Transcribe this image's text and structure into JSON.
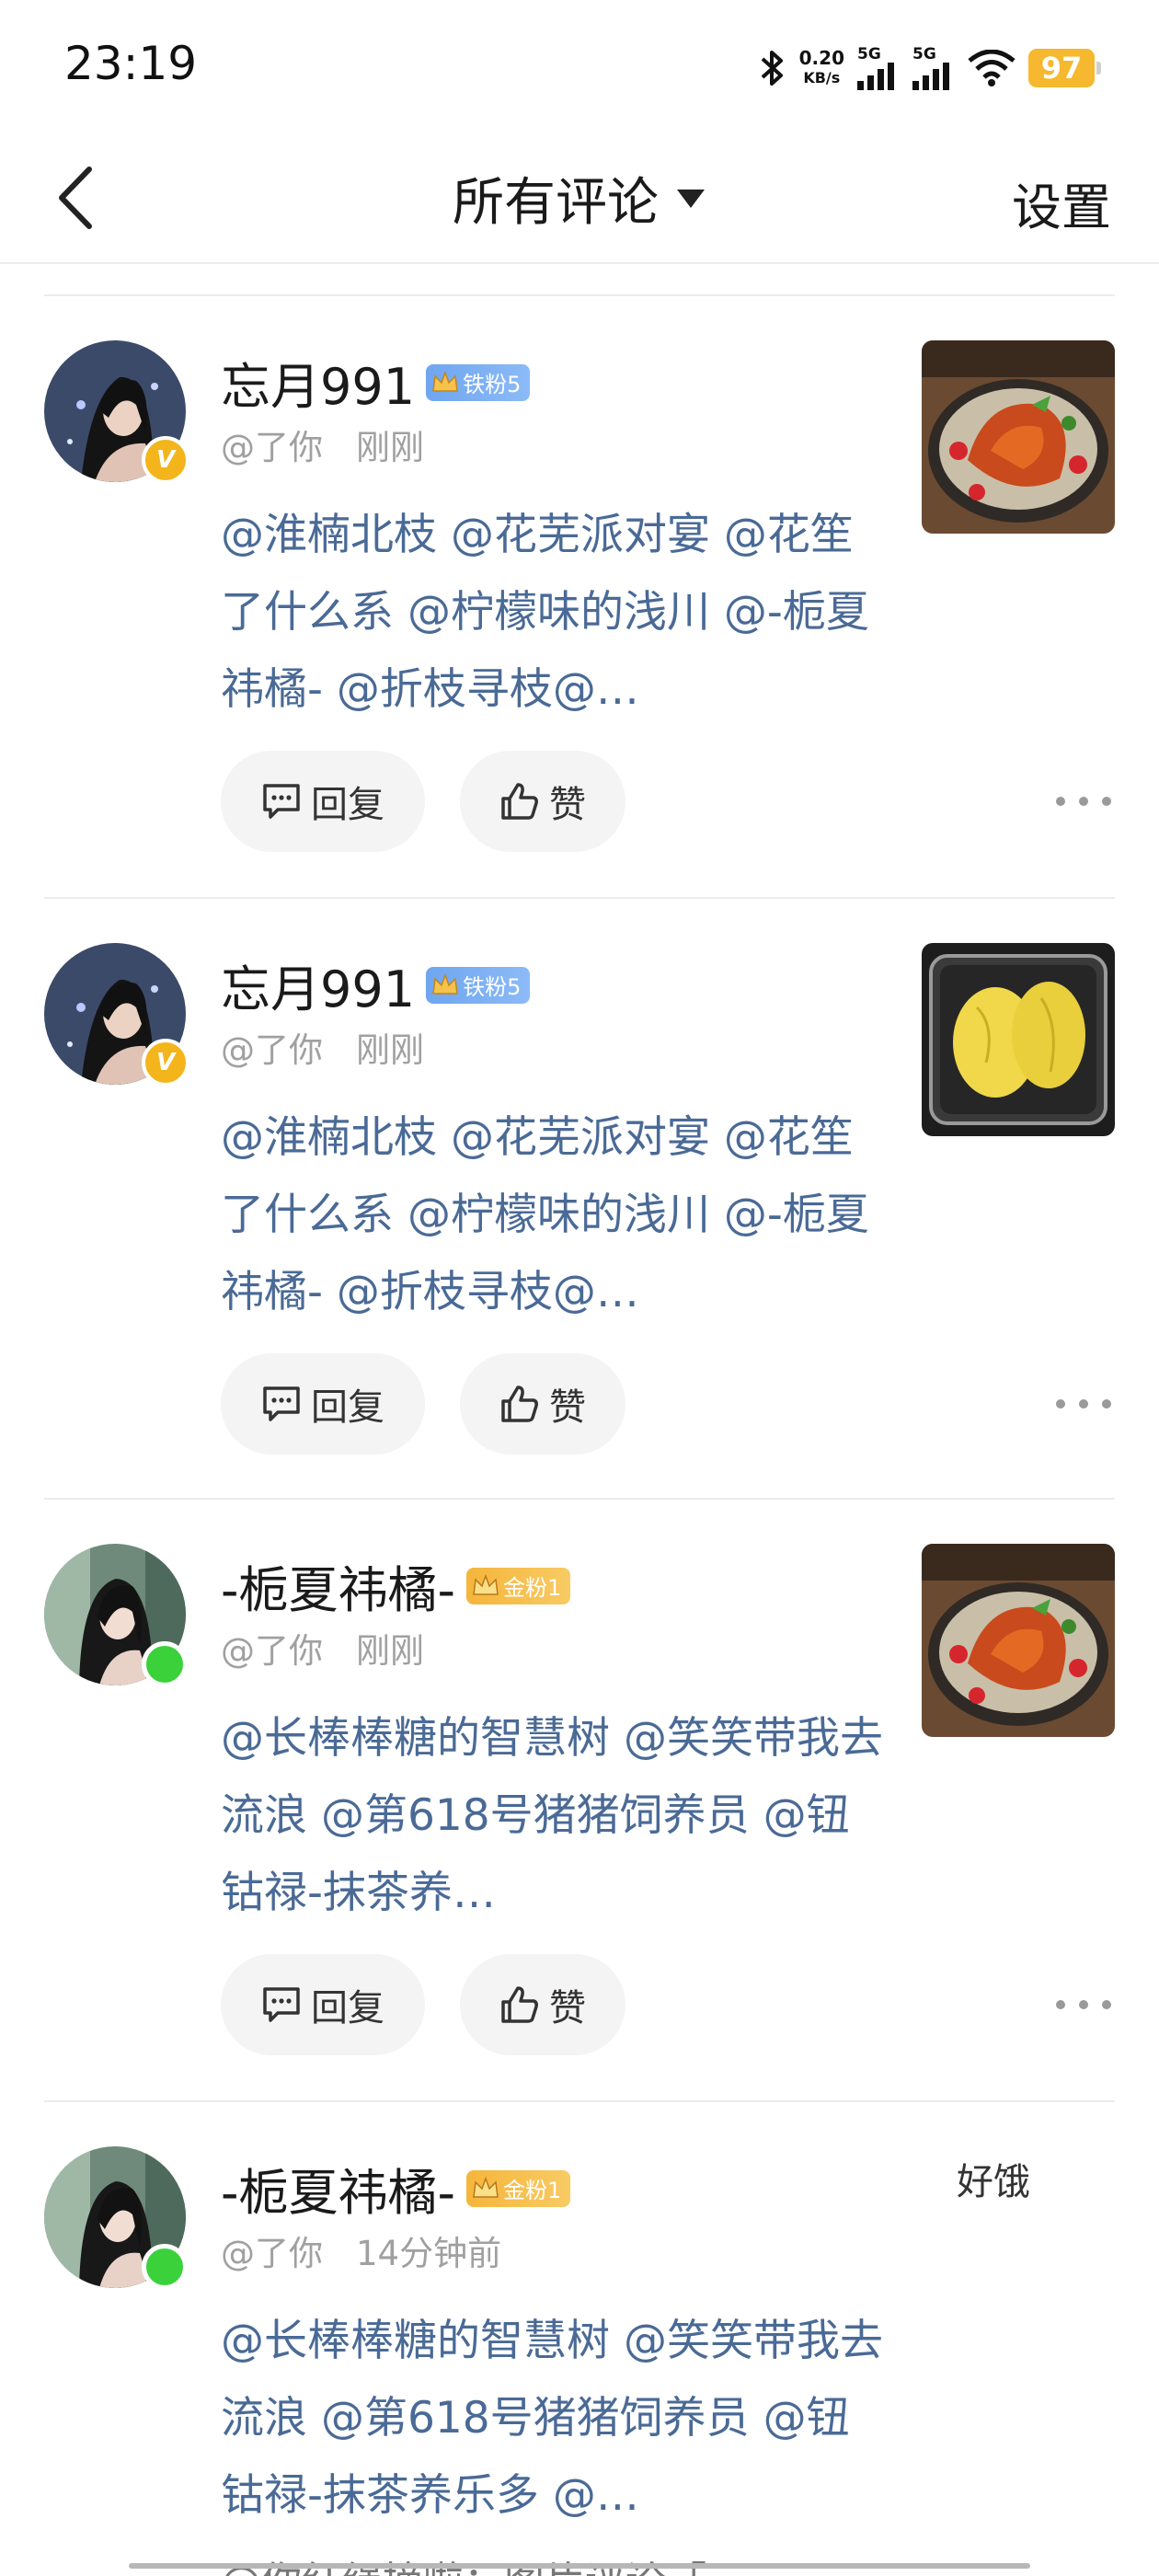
{
  "status_bar": {
    "time": "23:19",
    "net_speed_value": "0.20",
    "net_speed_unit": "KB/s",
    "sim1": "5G",
    "sim2": "5G",
    "battery": "97"
  },
  "header": {
    "title": "所有评论",
    "settings": "设置"
  },
  "comments": [
    {
      "name": "忘月991",
      "fan_badge": "铁粉5",
      "meta_prefix": "@了你",
      "time": "刚刚",
      "text": "@淮楠北枝 @花芜派对宴 @花笙了什么系 @柠檬味的浅川 @-栀夏祎橘- @折枝寻枝@…",
      "reply": "回复",
      "like": "赞"
    },
    {
      "name": "忘月991",
      "fan_badge": "铁粉5",
      "meta_prefix": "@了你",
      "time": "刚刚",
      "text": "@淮楠北枝 @花芜派对宴 @花笙了什么系 @柠檬味的浅川 @-栀夏祎橘- @折枝寻枝@…",
      "reply": "回复",
      "like": "赞"
    },
    {
      "name": "-栀夏祎橘-",
      "fan_badge": "金粉1",
      "meta_prefix": "@了你",
      "time": "刚刚",
      "text": "@长棒棒糖的智慧树 @笑笑带我去流浪 @第618号猪猪饲养员 @钮钴禄-抹茶养…",
      "reply": "回复",
      "like": "赞"
    },
    {
      "name": "-栀夏祎橘-",
      "fan_badge": "金粉1",
      "meta_prefix": "@了你",
      "time": "14分钟前",
      "text": "@长棒棒糖的智慧树 @笑笑带我去流浪 @第618号猪猪饲养员 @钮钴禄-抹茶养乐多 @…",
      "side_text": "好饿"
    }
  ],
  "bottom_peek": "@你红绳摘啦：图片评论「"
}
